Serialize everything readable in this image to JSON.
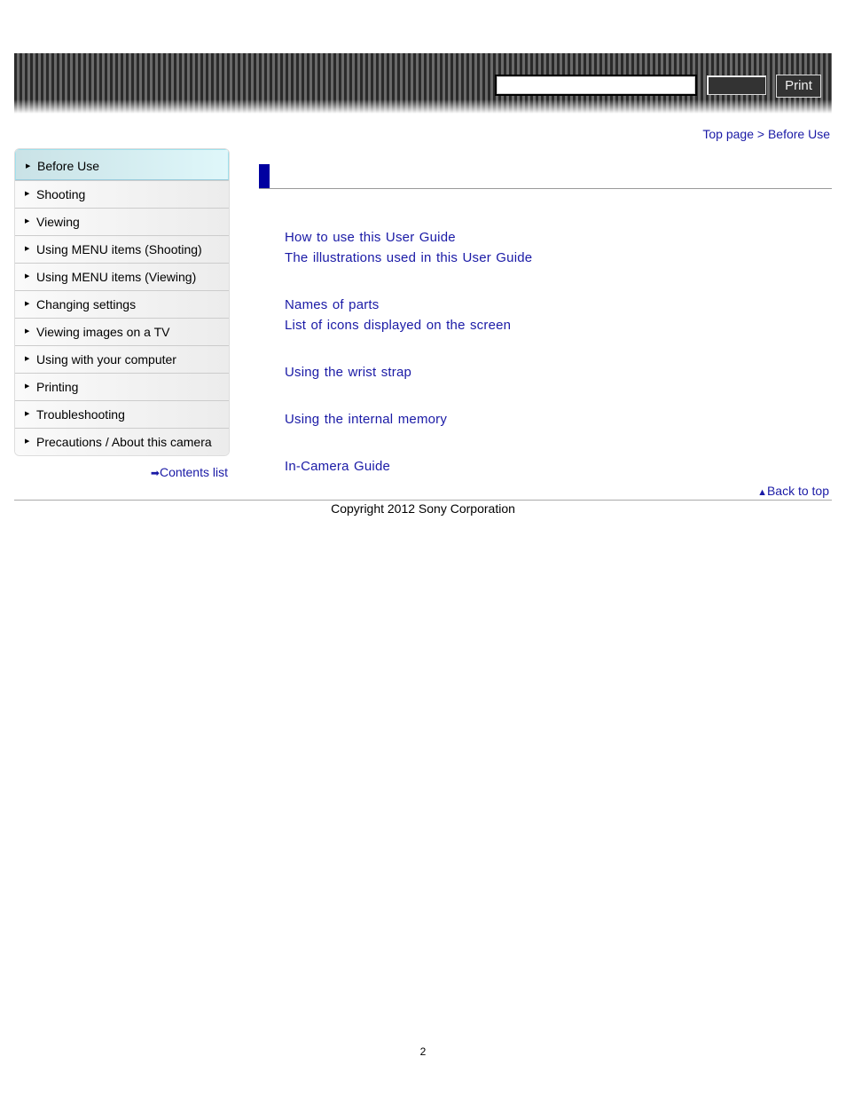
{
  "header": {
    "search_value": "",
    "print_label": "Print"
  },
  "breadcrumb": {
    "top": "Top page",
    "sep": " > ",
    "current": "Before Use"
  },
  "sidebar": {
    "items": [
      {
        "label": "Before Use",
        "active": true
      },
      {
        "label": "Shooting"
      },
      {
        "label": "Viewing"
      },
      {
        "label": "Using MENU items (Shooting)"
      },
      {
        "label": "Using MENU items (Viewing)"
      },
      {
        "label": "Changing settings"
      },
      {
        "label": "Viewing images on a TV"
      },
      {
        "label": "Using with your computer"
      },
      {
        "label": "Printing"
      },
      {
        "label": "Troubleshooting"
      },
      {
        "label": "Precautions / About this camera"
      }
    ],
    "contents_list": "Contents list"
  },
  "main": {
    "links": [
      "How to use this User Guide",
      "The illustrations used in this User Guide",
      "Names of parts",
      "List of icons displayed on the screen",
      "Using the wrist strap",
      "Using the internal memory",
      "In-Camera Guide"
    ]
  },
  "back_to_top": "Back to top",
  "copyright": "Copyright 2012 Sony Corporation",
  "page_number": "2",
  "colors": {
    "link": "#1a1aa6",
    "accent_bar": "#0000a0"
  }
}
